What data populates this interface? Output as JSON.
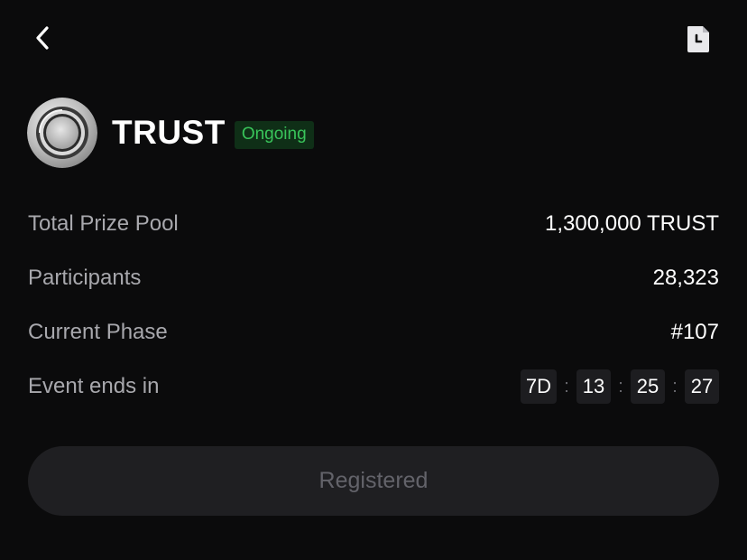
{
  "nav": {
    "back_icon": "chevron-left-icon",
    "history_icon": "document-clock-icon"
  },
  "header": {
    "token_name": "TRUST",
    "status": "Ongoing",
    "logo_icon": "trust-coin-logo"
  },
  "info_rows": [
    {
      "label": "Total Prize Pool",
      "value": "1,300,000 TRUST"
    },
    {
      "label": "Participants",
      "value": "28,323"
    },
    {
      "label": "Current Phase",
      "value": "#107"
    },
    {
      "label": "Event ends in"
    }
  ],
  "countdown": {
    "days": "7D",
    "hours": "13",
    "minutes": "25",
    "seconds": "27",
    "separator": ":"
  },
  "actions": {
    "register_label": "Registered"
  },
  "colors": {
    "background": "#0b0b0c",
    "status_green": "#39c45a",
    "status_bg": "#0f2f17",
    "label_gray": "#a8a8ad",
    "button_bg": "#1f1f22",
    "button_text": "#63636a"
  }
}
